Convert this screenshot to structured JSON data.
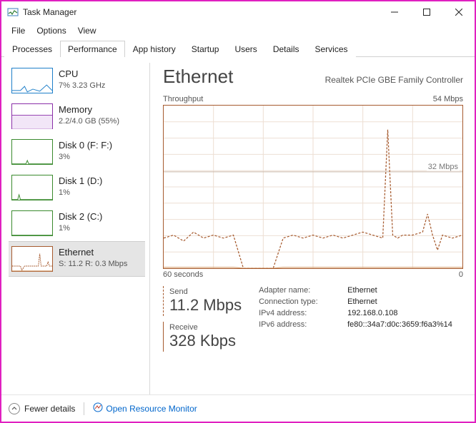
{
  "window": {
    "title": "Task Manager",
    "menu": [
      "File",
      "Options",
      "View"
    ],
    "tabs": [
      "Processes",
      "Performance",
      "App history",
      "Startup",
      "Users",
      "Details",
      "Services"
    ],
    "active_tab_index": 1
  },
  "sidebar": {
    "items": [
      {
        "title": "CPU",
        "sub": "7% 3.23 GHz",
        "thumb_color": "#1e7fc9",
        "selected": false
      },
      {
        "title": "Memory",
        "sub": "2.2/4.0 GB (55%)",
        "thumb_color": "#8a2fa8",
        "selected": false
      },
      {
        "title": "Disk 0 (F: F:)",
        "sub": "3%",
        "thumb_color": "#3a8a2e",
        "selected": false
      },
      {
        "title": "Disk 1 (D:)",
        "sub": "1%",
        "thumb_color": "#3a8a2e",
        "selected": false
      },
      {
        "title": "Disk 2 (C:)",
        "sub": "1%",
        "thumb_color": "#3a8a2e",
        "selected": false
      },
      {
        "title": "Ethernet",
        "sub": "S: 11.2 R: 0.3 Mbps",
        "thumb_color": "#a65a2e",
        "selected": true
      }
    ]
  },
  "main": {
    "title": "Ethernet",
    "subtitle": "Realtek PCIe GBE Family Controller",
    "chart_label_left": "Throughput",
    "chart_label_right": "54 Mbps",
    "chart_axis_left": "60 seconds",
    "chart_axis_right": "0",
    "ref_line_label": "32 Mbps",
    "send_label": "Send",
    "send_value": "11.2 Mbps",
    "recv_label": "Receive",
    "recv_value": "328 Kbps",
    "info": {
      "adapter_name_label": "Adapter name:",
      "adapter_name_value": "Ethernet",
      "conn_type_label": "Connection type:",
      "conn_type_value": "Ethernet",
      "ipv4_label": "IPv4 address:",
      "ipv4_value": "192.168.0.108",
      "ipv6_label": "IPv6 address:",
      "ipv6_value": "fe80::34a7:d0c:3659:f6a3%14"
    }
  },
  "footer": {
    "fewer_label": "Fewer details",
    "resmon_label": "Open Resource Monitor"
  },
  "colors": {
    "chart_border": "#a65a2e",
    "chart_grid": "#eddfd4",
    "chart_send": "#a65a2e",
    "chart_recv": "#d9a67a"
  },
  "chart_data": {
    "type": "line",
    "title": "Throughput",
    "xlabel": "seconds",
    "ylabel": "Mbps",
    "xlim": [
      60,
      0
    ],
    "ylim": [
      0,
      54
    ],
    "reference_lines": [
      32
    ],
    "x": [
      60,
      58,
      56,
      54,
      52,
      50,
      48,
      46,
      44,
      42,
      40,
      38,
      36,
      34,
      32,
      30,
      28,
      26,
      24,
      22,
      20,
      18,
      16,
      15,
      14,
      13,
      12,
      10,
      8,
      7,
      6,
      5,
      4,
      2,
      0
    ],
    "series": [
      {
        "name": "Send",
        "style": "dashed",
        "values": [
          10,
          11,
          9,
          12,
          10,
          11,
          10,
          11,
          0,
          0,
          0,
          0,
          10,
          11,
          10,
          11,
          10,
          11,
          10,
          11,
          12,
          11,
          10,
          46,
          11,
          10,
          11,
          11,
          12,
          18,
          11,
          6,
          11,
          10,
          11
        ]
      },
      {
        "name": "Receive",
        "style": "solid",
        "values": [
          0.3,
          0.3,
          0.3,
          0.3,
          0.3,
          0.3,
          0.3,
          0.3,
          0,
          0,
          0,
          0,
          0.3,
          0.3,
          0.3,
          0.3,
          0.3,
          0.3,
          0.3,
          0.3,
          0.3,
          0.3,
          0.3,
          0.3,
          0.3,
          0.3,
          0.3,
          0.3,
          0.3,
          0.3,
          0.3,
          0.3,
          0.3,
          0.3,
          0.3
        ]
      }
    ]
  }
}
